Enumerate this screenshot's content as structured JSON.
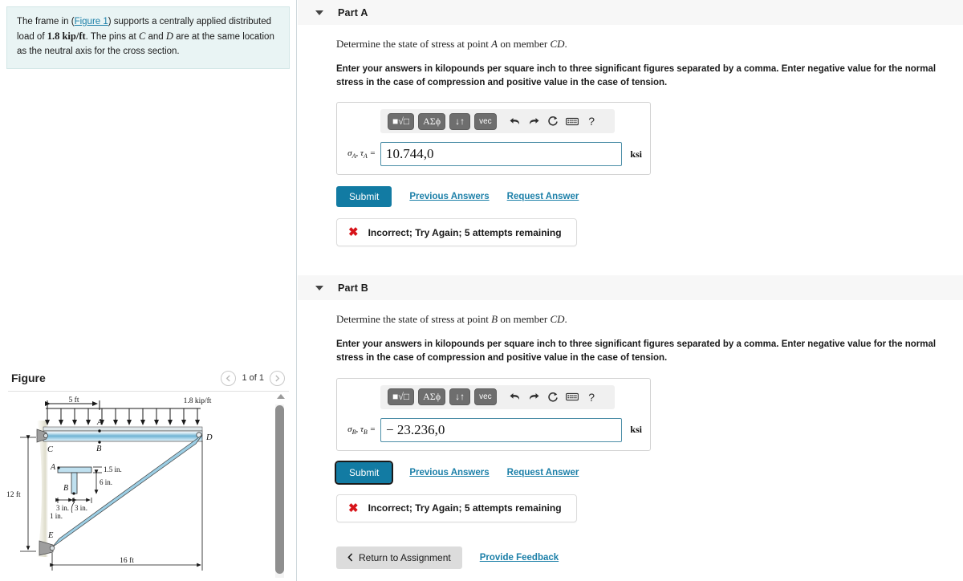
{
  "problem": {
    "text_before_link": "The frame in (",
    "link_text": "Figure 1",
    "text_after_link": ") supports a centrally applied distributed load of ",
    "load_value": "1.8 kip/ft",
    "text_2": ". The pins at ",
    "pin_c": "C",
    "text_and": " and ",
    "pin_d": "D",
    "text_3": " are at the same location as the neutral axis for the cross section."
  },
  "figure": {
    "title": "Figure",
    "prev_icon": "chevron-left-icon",
    "next_icon": "chevron-right-icon",
    "counter": "1 of 1",
    "labels": {
      "dim_5ft": "5 ft",
      "dim_16ft": "16 ft",
      "dim_12ft": "12 ft",
      "load": "1.8 kip/ft",
      "pt_A_beam": "A",
      "pt_B_beam": "B",
      "pt_C": "C",
      "pt_D": "D",
      "pt_E": "E",
      "sec_A": "A",
      "sec_B": "B",
      "flange_thk": "1.5 in.",
      "web_depth": "6 in.",
      "half_left": "3 in.",
      "half_right": "3 in.",
      "web_thk": "1 in."
    }
  },
  "parts": [
    {
      "id": "a",
      "header": "Part A",
      "caret_icon": "caret-down-icon",
      "prompt_pre": "Determine the state of stress at point ",
      "prompt_point": "A",
      "prompt_mid": " on member ",
      "prompt_member": "CD",
      "prompt_post": ".",
      "instructions": "Enter your answers in kilopounds per square inch to three significant figures separated by a comma. Enter negative value for the normal stress in the case of compression and positive value in the case of tension.",
      "toolbar": {
        "btn_sqrt": "■√□",
        "btn_greek": "ΑΣϕ",
        "btn_arrows": "↓↑",
        "btn_vec": "vec",
        "icon_undo": "undo-icon",
        "icon_redo": "redo-icon",
        "icon_reset": "reset-icon",
        "icon_keyboard": "keyboard-icon",
        "icon_help": "?"
      },
      "var_sigma": "σ",
      "var_sigma_sub": "A",
      "var_tau": "τ",
      "var_tau_sub": "A",
      "equals": "=",
      "answer_value": "10.744,0",
      "unit": "ksi",
      "submit_label": "Submit",
      "submit_focused": false,
      "previous_answers_label": "Previous Answers",
      "request_answer_label": "Request Answer",
      "alert_icon": "x-mark-icon",
      "alert_text": "Incorrect; Try Again; 5 attempts remaining"
    },
    {
      "id": "b",
      "header": "Part B",
      "caret_icon": "caret-down-icon",
      "prompt_pre": "Determine the state of stress at point ",
      "prompt_point": "B",
      "prompt_mid": " on member ",
      "prompt_member": "CD",
      "prompt_post": ".",
      "instructions": "Enter your answers in kilopounds per square inch to three significant figures separated by a comma. Enter negative value for the normal stress in the case of compression and positive value in the case of tension.",
      "toolbar": {
        "btn_sqrt": "■√□",
        "btn_greek": "ΑΣϕ",
        "btn_arrows": "↓↑",
        "btn_vec": "vec",
        "icon_undo": "undo-icon",
        "icon_redo": "redo-icon",
        "icon_reset": "reset-icon",
        "icon_keyboard": "keyboard-icon",
        "icon_help": "?"
      },
      "var_sigma": "σ",
      "var_sigma_sub": "B",
      "var_tau": "τ",
      "var_tau_sub": "B",
      "equals": "=",
      "answer_value": "− 23.236,0",
      "unit": "ksi",
      "submit_label": "Submit",
      "submit_focused": true,
      "previous_answers_label": "Previous Answers",
      "request_answer_label": "Request Answer",
      "alert_icon": "x-mark-icon",
      "alert_text": "Incorrect; Try Again; 5 attempts remaining"
    }
  ],
  "footer": {
    "return_icon": "chevron-left-icon",
    "return_label": "Return to Assignment",
    "feedback_label": "Provide Feedback"
  },
  "colors": {
    "accent": "#127ba3",
    "link": "#1b7fa8",
    "error": "#d7141a",
    "panel_bg": "#e9f4f4",
    "header_bg": "#f7f7f7"
  }
}
